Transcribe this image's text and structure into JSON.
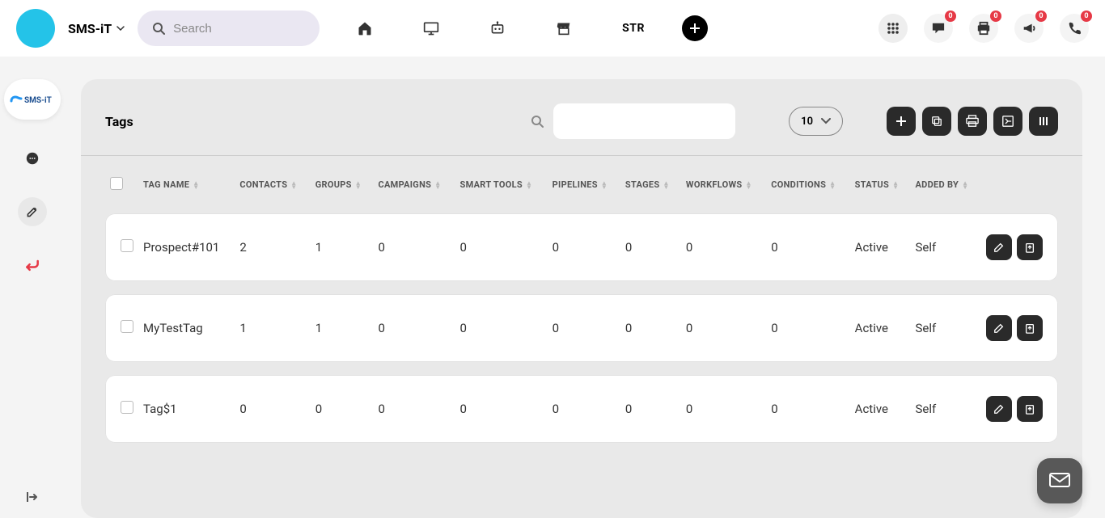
{
  "brand": {
    "name": "SMS-iT"
  },
  "search": {
    "placeholder": "Search"
  },
  "top_center": {
    "str_label": "STR"
  },
  "badges": {
    "chat": "0",
    "print": "0",
    "announce": "0",
    "phone": "0"
  },
  "panel": {
    "title": "Tags",
    "page_size": "10"
  },
  "columns": [
    "TAG NAME",
    "CONTACTS",
    "GROUPS",
    "CAMPAIGNS",
    "SMART TOOLS",
    "PIPELINES",
    "STAGES",
    "WORKFLOWS",
    "CONDITIONS",
    "STATUS",
    "ADDED BY"
  ],
  "rows": [
    {
      "name": "Prospect#101",
      "contacts": "2",
      "groups": "1",
      "campaigns": "0",
      "smart": "0",
      "pipelines": "0",
      "stages": "0",
      "workflows": "0",
      "conditions": "0",
      "status": "Active",
      "added": "Self"
    },
    {
      "name": "MyTestTag",
      "contacts": "1",
      "groups": "1",
      "campaigns": "0",
      "smart": "0",
      "pipelines": "0",
      "stages": "0",
      "workflows": "0",
      "conditions": "0",
      "status": "Active",
      "added": "Self"
    },
    {
      "name": "Tag$1",
      "contacts": "0",
      "groups": "0",
      "campaigns": "0",
      "smart": "0",
      "pipelines": "0",
      "stages": "0",
      "workflows": "0",
      "conditions": "0",
      "status": "Active",
      "added": "Self"
    }
  ]
}
